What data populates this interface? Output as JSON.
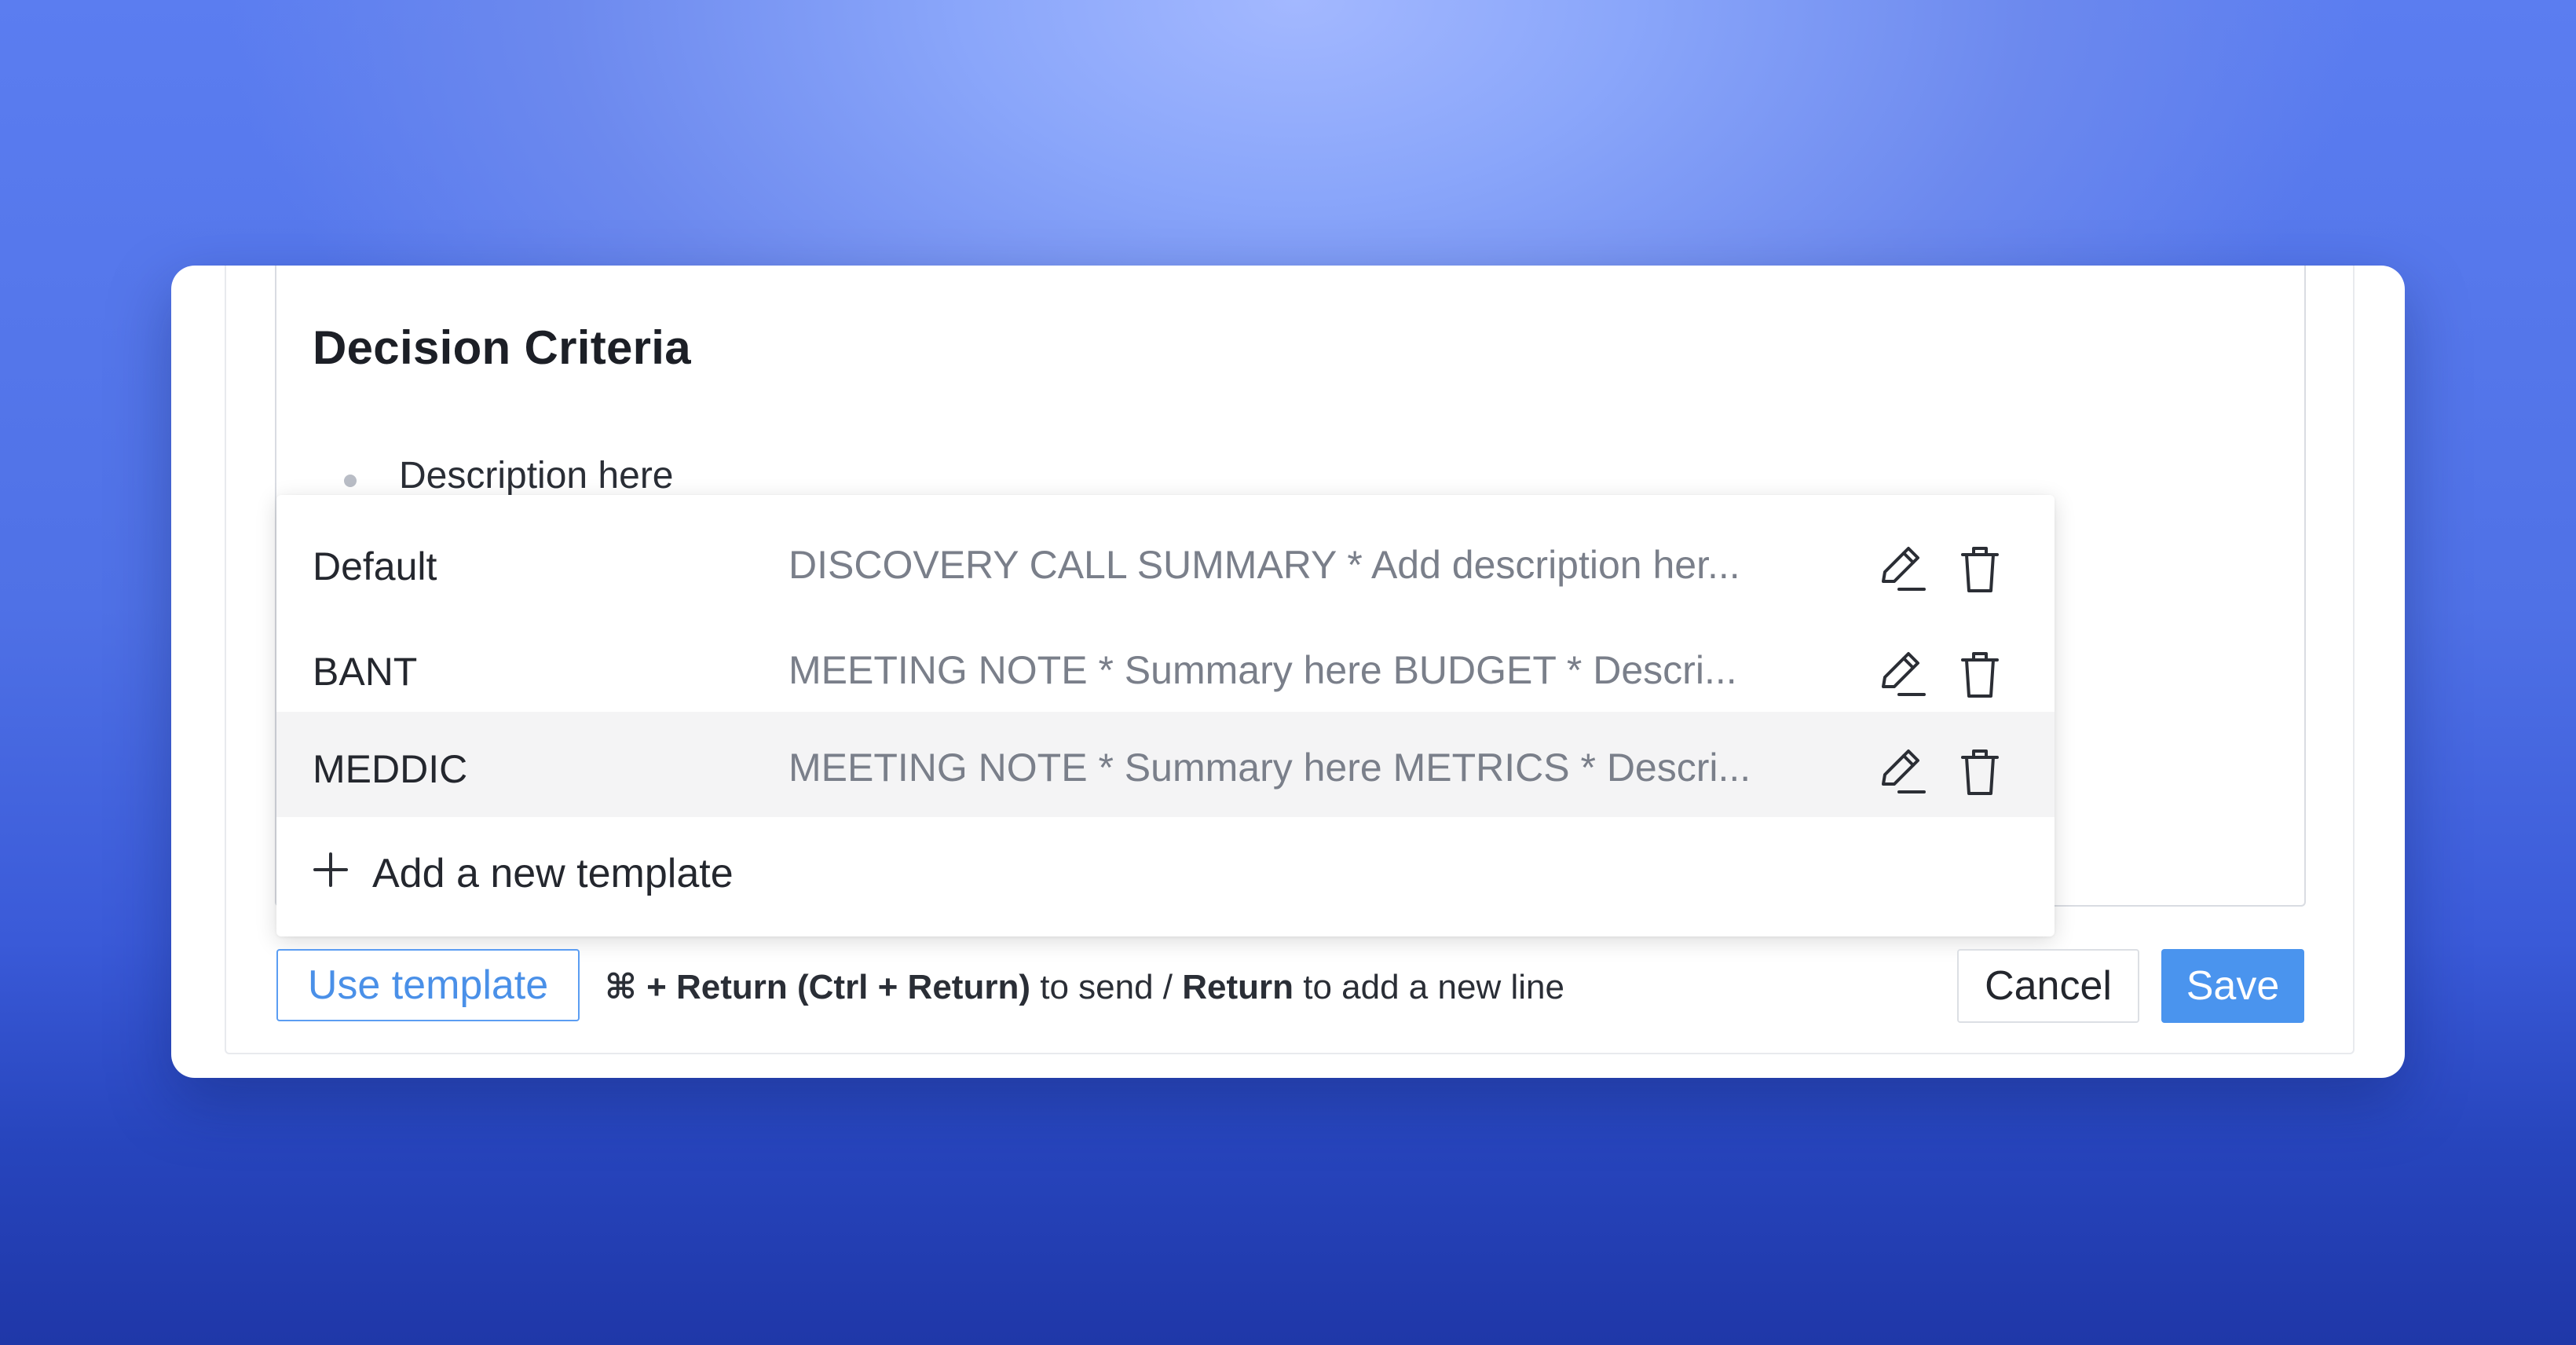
{
  "editor": {
    "heading": "Decision Criteria",
    "bullet_text": "Description here"
  },
  "templates": [
    {
      "name": "Default",
      "preview": "DISCOVERY CALL SUMMARY * Add description her...",
      "selected": false
    },
    {
      "name": "BANT",
      "preview": "MEETING NOTE * Summary here BUDGET * Descri...",
      "selected": false
    },
    {
      "name": "MEDDIC",
      "preview": "MEETING NOTE * Summary here METRICS * Descri...",
      "selected": true
    }
  ],
  "add_template_label": "Add a new template",
  "footer": {
    "use_template_label": "Use template",
    "hint": {
      "cmd_symbol": "⌘",
      "part1": "+ Return (Ctrl + Return)",
      "part2": "to send /",
      "part3": "Return",
      "part4": "to add a new line"
    },
    "cancel_label": "Cancel",
    "save_label": "Save"
  },
  "colors": {
    "primary": "#4a94ee",
    "selected_row": "#f4f4f5",
    "background_gradient_top": "#a3b8ff",
    "background_gradient_bottom": "#1f37a8"
  },
  "icons": [
    "pencil-icon",
    "trash-icon",
    "plus-icon"
  ]
}
